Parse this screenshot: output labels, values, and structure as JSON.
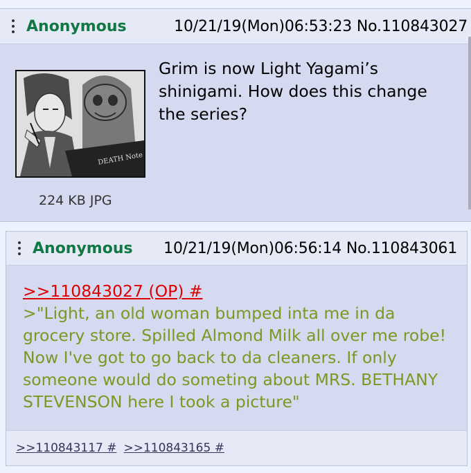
{
  "post1": {
    "name": "Anonymous",
    "date_no": "10/21/19(Mon)06:53:23 No.110843027",
    "image_caption": "DEATH Note",
    "text": "Grim is now Light Yagami’s shinigami. How does this change the series?",
    "file_info": "224 KB JPG"
  },
  "post2": {
    "name": "Anonymous",
    "date_no": "10/21/19(Mon)06:56:14 No.110843061",
    "quote_link": ">>110843027 (OP) #",
    "greentext": ">\"Light, an old woman bumped inta me in da grocery store. Spilled Almond Milk all over me robe! Now I've got to go back to da cleaners. If only someone would do someting about MRS. BETHANY STEVENSON here I took a picture\"",
    "replies": [
      ">>110843117 #",
      ">>110843165 #"
    ]
  },
  "colors": {
    "post_bg": "#d6daf0",
    "header_bg": "#e6e9f6",
    "name": "#117743",
    "greentext": "#789922",
    "quotelink": "#dd0000"
  }
}
